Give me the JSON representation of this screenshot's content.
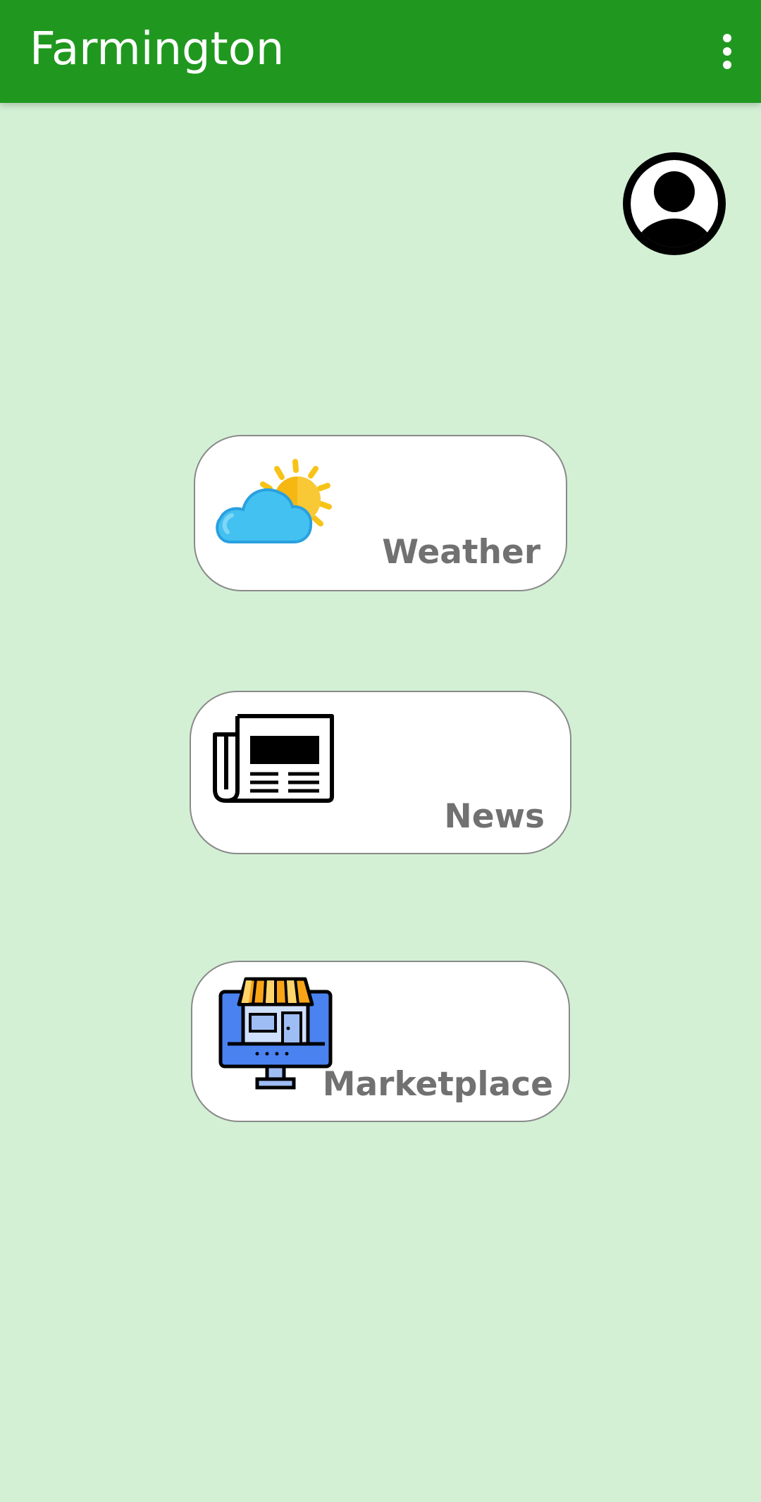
{
  "app_bar": {
    "title": "Farmington",
    "menu_icon": "more-vert-icon",
    "color": "#20981f"
  },
  "profile": {
    "icon": "account-circle-icon"
  },
  "cards": [
    {
      "label": "Weather",
      "icon": "weather-icon"
    },
    {
      "label": "News",
      "icon": "newspaper-icon"
    },
    {
      "label": "Marketplace",
      "icon": "storefront-icon"
    }
  ],
  "colors": {
    "background": "#d3f0d4",
    "label_text": "#717171"
  }
}
